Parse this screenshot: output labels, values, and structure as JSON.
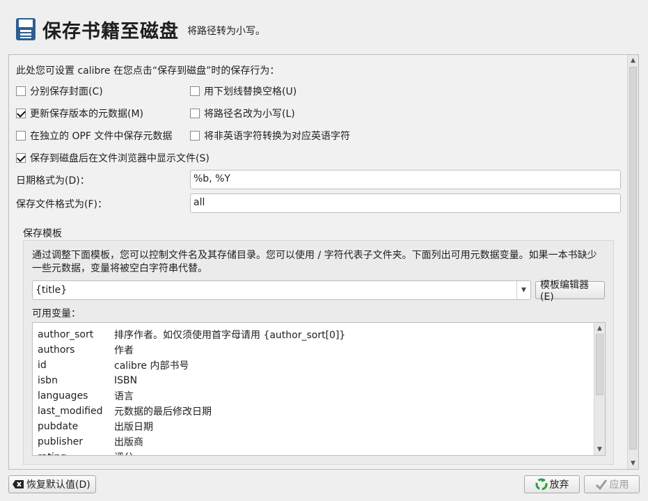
{
  "header": {
    "title": "保存书籍至磁盘",
    "subtitle": "将路径转为小写。"
  },
  "intro": "此处您可设置 calibre 在您点击“保存到磁盘”时的保存行为：",
  "options": {
    "save_cover": {
      "label": "分别保存封面(C)",
      "checked": false
    },
    "replace_underscore": {
      "label": "用下划线替换空格(U)",
      "checked": false
    },
    "update_metadata": {
      "label": "更新保存版本的元数据(M)",
      "checked": true
    },
    "lowercase_path": {
      "label": "将路径名改为小写(L)",
      "checked": false
    },
    "separate_opf": {
      "label": "在独立的 OPF 文件中保存元数据",
      "checked": false
    },
    "ascii_filename": {
      "label": "将非英语字符转换为对应英语字符",
      "checked": false
    },
    "show_in_browser": {
      "label": "保存到磁盘后在文件浏览器中显示文件(S)",
      "checked": true
    }
  },
  "date_format": {
    "label": "日期格式为(D)：",
    "value": "%b, %Y"
  },
  "file_format": {
    "label": "保存文件格式为(F)：",
    "value": "all"
  },
  "template_group": {
    "title": "保存模板",
    "description": "通过调整下面模板，您可以控制文件名及其存储目录。您可以使用 / 字符代表子文件夹。下面列出可用元数据变量。如果一本书缺少一些元数据，变量将被空白字符串代替。",
    "template_value": "{title}",
    "editor_button": "模板编辑器(E)",
    "vars_label": "可用变量：",
    "variables": [
      {
        "name": "author_sort",
        "desc": "排序作者。如仅须使用首字母请用 {author_sort[0]}"
      },
      {
        "name": "authors",
        "desc": "作者"
      },
      {
        "name": "id",
        "desc": "calibre 内部书号"
      },
      {
        "name": "isbn",
        "desc": "ISBN"
      },
      {
        "name": "languages",
        "desc": "语言"
      },
      {
        "name": "last_modified",
        "desc": "元数据的最后修改日期"
      },
      {
        "name": "pubdate",
        "desc": "出版日期"
      },
      {
        "name": "publisher",
        "desc": "出版商"
      },
      {
        "name": "rating",
        "desc": "评分"
      }
    ]
  },
  "buttons": {
    "restore": "恢复默认值(D)",
    "discard": "放弃",
    "apply": "应用"
  },
  "icons": {
    "header": "floppy-disk-icon",
    "restore": "close-x-icon",
    "discard": "recycle-icon",
    "apply": "checkmark-icon"
  },
  "colors": {
    "disk": "#2d5e8e",
    "recycle": "#2e9d3a",
    "apply_disabled": "#9a9a9a"
  }
}
